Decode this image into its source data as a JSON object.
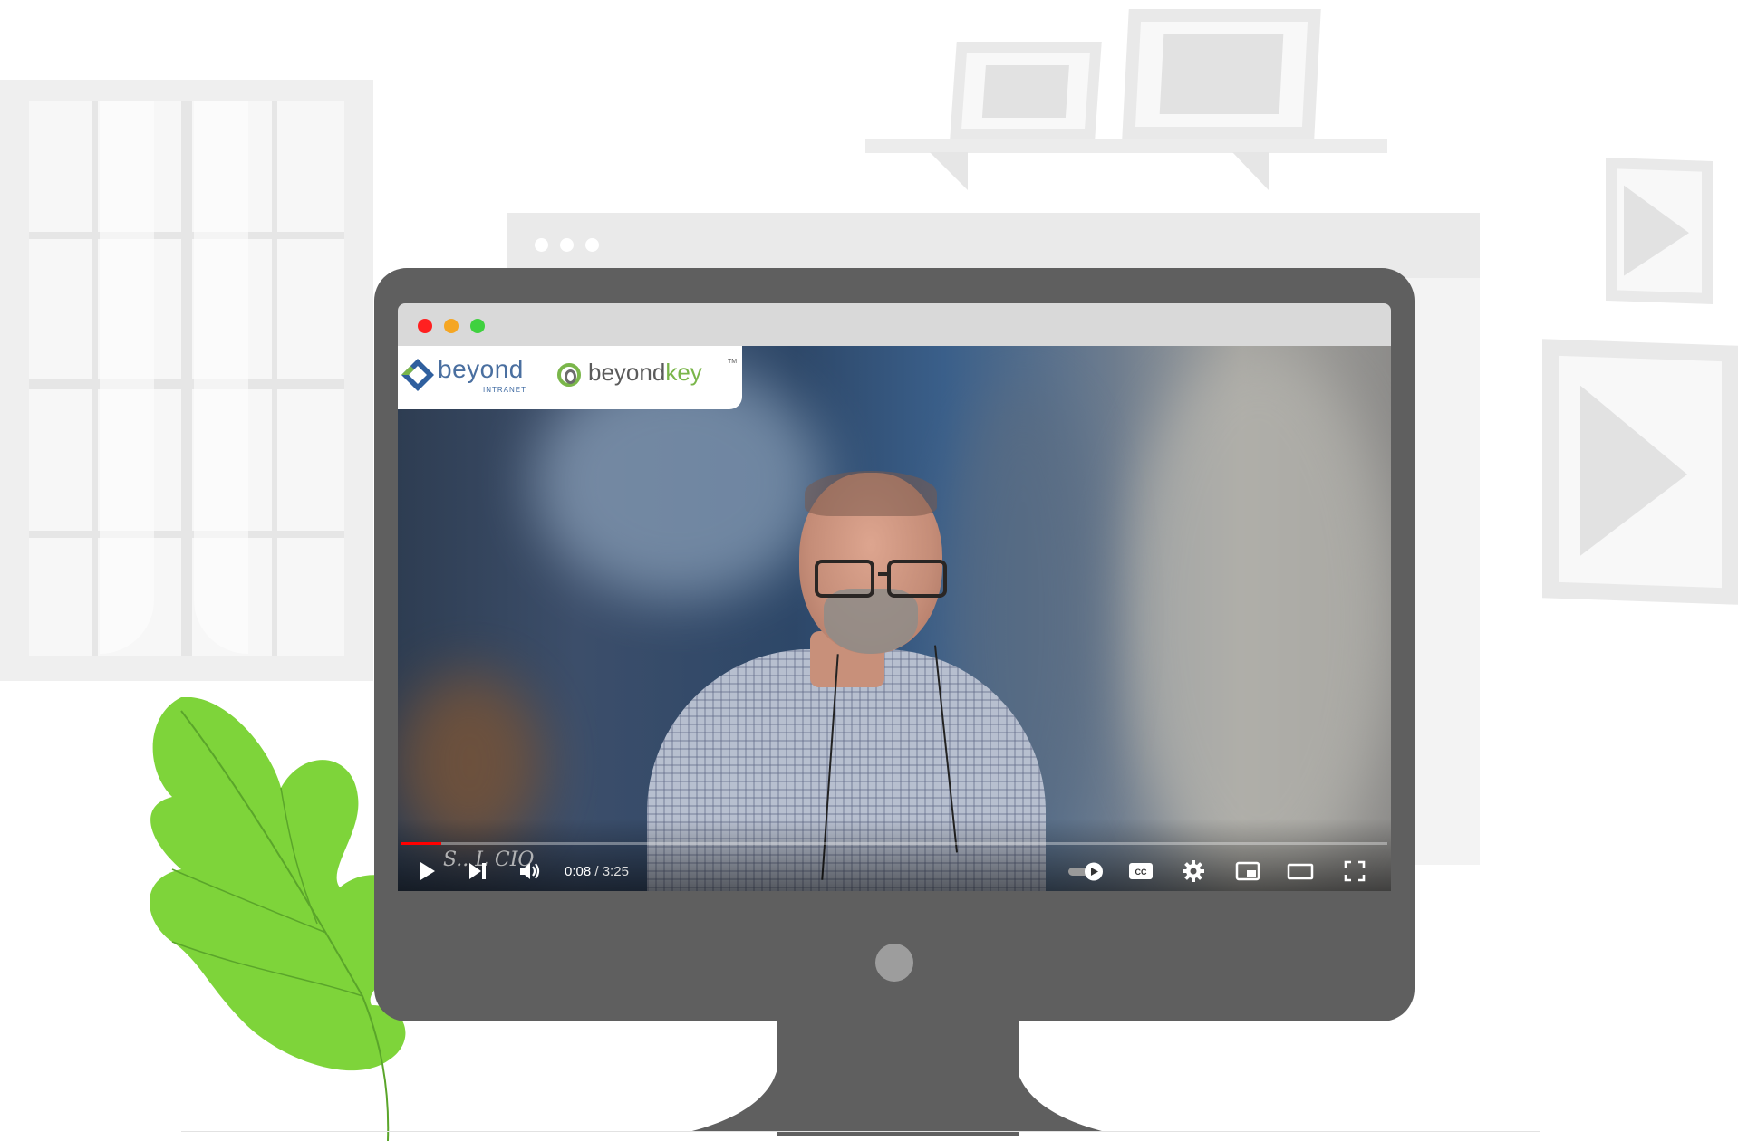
{
  "video": {
    "logo_brand_1": "beyond",
    "logo_brand_1_sub": "INTRANET",
    "logo_brand_2_main": "beyond",
    "logo_brand_2_accent": "key",
    "logo_tm": "TM",
    "overlay_caption": "S.. L  CIO",
    "time_current": "0:08",
    "time_separator": " / ",
    "time_total": "3:25",
    "progress": 0.04
  },
  "controls": {
    "play_icon": "play-icon",
    "next_icon": "next-icon",
    "volume_icon": "volume-icon",
    "autoplay_icon": "autoplay-toggle-icon",
    "cc_icon": "captions-icon",
    "settings_icon": "gear-icon",
    "miniplayer_icon": "miniplayer-icon",
    "theater_icon": "theater-mode-icon",
    "fullscreen_icon": "fullscreen-icon",
    "cc_label": "CC"
  },
  "colors": {
    "progress": "#ff0000",
    "traffic_red": "#ff2020",
    "traffic_yellow": "#f5a623",
    "traffic_green": "#3fd13f",
    "leaf": "#7ed43a",
    "monitor": "#5f5f5f"
  }
}
